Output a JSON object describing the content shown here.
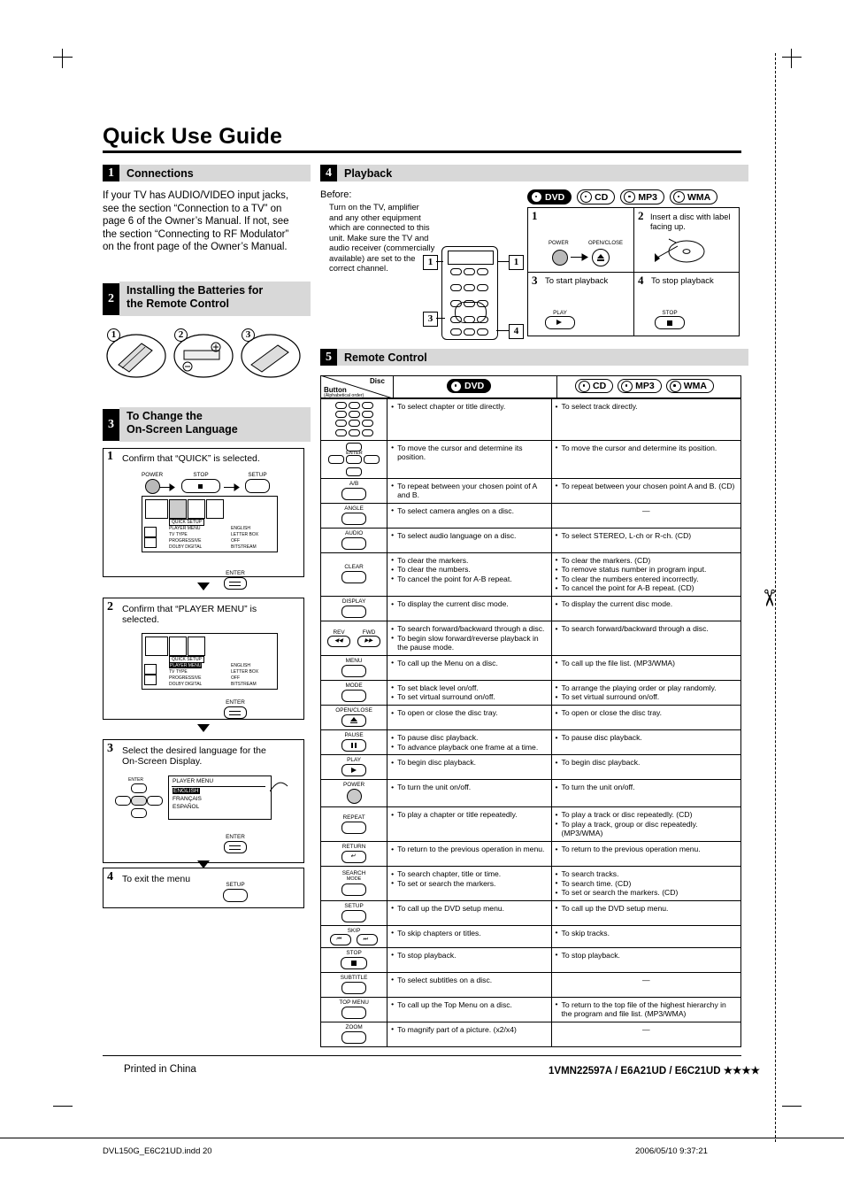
{
  "title": "Quick Use Guide",
  "sections": {
    "s1": {
      "num": "1",
      "title": "Connections",
      "body": "If your TV has AUDIO/VIDEO input jacks, see the section “Connection to a TV” on page 6 of the Owner’s Manual. If not, see the section “Connecting to RF Modulator” on the front page of the Owner’s Manual."
    },
    "s2": {
      "num": "2",
      "title_l1": "Installing the Batteries for",
      "title_l2": "the Remote Control",
      "steps": [
        "1",
        "2",
        "3"
      ]
    },
    "s3": {
      "num": "3",
      "title_l1": "To Change the",
      "title_l2": "On-Screen Language",
      "step1": {
        "n": "1",
        "text": "Confirm that “QUICK” is selected.",
        "power": "POWER",
        "stop": "STOP",
        "setup": "SETUP",
        "enter": "ENTER",
        "osd_title": "QUICK SETUP",
        "osd_rows": [
          {
            "l": "PLAYER MENU",
            "r": "ENGLISH"
          },
          {
            "l": "TV TYPE",
            "r": "LETTER BOX"
          },
          {
            "l": "PROGRESSIVE",
            "r": "OFF"
          },
          {
            "l": "DOLBY DIGITAL",
            "r": "BITSTREAM"
          }
        ]
      },
      "step2": {
        "n": "2",
        "text": "Confirm that “PLAYER MENU” is selected.",
        "enter": "ENTER",
        "osd_title": "QUICK SETUP",
        "osd_rows": [
          {
            "l": "PLAYER MENU",
            "r": "ENGLISH"
          },
          {
            "l": "TV TYPE",
            "r": "LETTER BOX"
          },
          {
            "l": "PROGRESSIVE",
            "r": "OFF"
          },
          {
            "l": "DOLBY DIGITAL",
            "r": "BITSTREAM"
          }
        ]
      },
      "step3": {
        "n": "3",
        "text_l1": "Select the desired language for the",
        "text_l2": "On-Screen Display.",
        "enter": "ENTER",
        "menu_title": "PLAYER MENU",
        "menu_items": [
          "ENGLISH",
          "FRANÇAIS",
          "ESPAÑOL"
        ]
      },
      "step4": {
        "n": "4",
        "text": "To exit the menu",
        "setup": "SETUP"
      }
    },
    "s4": {
      "num": "4",
      "title": "Playback",
      "before_label": "Before:",
      "before_text": "Turn on the TV, amplifier and any other equipment which are connected to this unit. Make sure the TV and audio receiver (commercially available) are set to the correct channel.",
      "badges": [
        "DVD",
        "CD",
        "MP3",
        "WMA"
      ],
      "steps": [
        {
          "n": "1",
          "label": "",
          "power": "POWER",
          "openclose": "OPEN/CLOSE"
        },
        {
          "n": "2",
          "label": "Insert a disc with label facing up."
        },
        {
          "n": "3",
          "label": "To start playback",
          "key": "PLAY"
        },
        {
          "n": "4",
          "label": "To stop playback",
          "key": "STOP"
        }
      ],
      "remote_callouts": [
        "1",
        "1",
        "3",
        "4"
      ]
    },
    "s5": {
      "num": "5",
      "title": "Remote Control",
      "header": {
        "button": "Button",
        "alpha": "(Alphabetical order)",
        "disc": "Disc",
        "col2_badge": "DVD",
        "col3_badges": [
          "CD",
          "MP3",
          "WMA"
        ]
      },
      "rows": [
        {
          "key": "NUMBER",
          "key_type": "numpad",
          "dvd": [
            "To select chapter or title directly."
          ],
          "cd": [
            "To select track directly."
          ]
        },
        {
          "key": "ENTER",
          "key_type": "cursor",
          "dvd": [
            "To move the cursor and determine its position."
          ],
          "cd": [
            "To move the cursor and determine its position."
          ]
        },
        {
          "key": "A/B",
          "key_type": "oval",
          "dvd": [
            "To repeat between your chosen point of A and B."
          ],
          "cd": [
            "To repeat between your chosen point A and B. (CD)"
          ]
        },
        {
          "key": "ANGLE",
          "key_type": "oval",
          "dvd": [
            "To select camera angles on a disc."
          ],
          "cd": [
            "—"
          ]
        },
        {
          "key": "AUDIO",
          "key_type": "oval",
          "dvd": [
            "To select audio language on a disc."
          ],
          "cd": [
            "To select STEREO, L-ch or R-ch. (CD)"
          ]
        },
        {
          "key": "CLEAR",
          "key_type": "oval",
          "dvd": [
            "To clear the markers.",
            "To clear the numbers.",
            "To cancel the point for A-B repeat."
          ],
          "cd": [
            "To clear the markers. (CD)",
            "To remove status number in program input.",
            "To clear the numbers entered incorrectly.",
            "To cancel the point for A-B repeat. (CD)"
          ]
        },
        {
          "key": "DISPLAY",
          "key_type": "oval",
          "dvd": [
            "To display the current disc mode."
          ],
          "cd": [
            "To display the current disc mode."
          ]
        },
        {
          "key": "REV/FWD",
          "key_type": "revfwd",
          "dvd": [
            "To search forward/backward through a disc.",
            "To begin slow forward/reverse playback in the pause mode."
          ],
          "cd": [
            "To search forward/backward through a disc."
          ]
        },
        {
          "key": "MENU",
          "key_type": "oval",
          "dvd": [
            "To call up the Menu on a disc."
          ],
          "cd": [
            "To call up the file list. (MP3/WMA)"
          ]
        },
        {
          "key": "MODE",
          "key_type": "oval",
          "dvd": [
            "To set black level on/off.",
            "To set virtual surround on/off."
          ],
          "cd": [
            "To arrange the playing order or play randomly.",
            "To set virtual surround on/off."
          ]
        },
        {
          "key": "OPEN/CLOSE",
          "key_type": "oval-eject",
          "dvd": [
            "To open or close the disc tray."
          ],
          "cd": [
            "To open or close the disc tray."
          ]
        },
        {
          "key": "PAUSE",
          "key_type": "oval-pause",
          "dvd": [
            "To pause disc playback.",
            "To advance playback one frame at a time."
          ],
          "cd": [
            "To pause disc playback."
          ]
        },
        {
          "key": "PLAY",
          "key_type": "oval-play",
          "dvd": [
            "To begin disc playback."
          ],
          "cd": [
            "To begin disc playback."
          ]
        },
        {
          "key": "POWER",
          "key_type": "round",
          "dvd": [
            "To turn the unit on/off."
          ],
          "cd": [
            "To turn the unit on/off."
          ]
        },
        {
          "key": "REPEAT",
          "key_type": "oval",
          "dvd": [
            "To play a chapter or title repeatedly."
          ],
          "cd": [
            "To play a track or disc repeatedly. (CD)",
            "To play a track, group or disc repeatedly. (MP3/WMA)"
          ]
        },
        {
          "key": "RETURN",
          "key_type": "oval-return",
          "dvd": [
            "To return to the previous operation in menu."
          ],
          "cd": [
            "To return to the previous operation menu."
          ]
        },
        {
          "key": "SEARCH MODE",
          "key_type": "oval-two",
          "dvd": [
            "To search chapter, title or time.",
            "To set or search the markers."
          ],
          "cd": [
            "To search tracks.",
            "To search time. (CD)",
            "To set or search the markers. (CD)"
          ]
        },
        {
          "key": "SETUP",
          "key_type": "oval",
          "dvd": [
            "To call up the DVD setup menu."
          ],
          "cd": [
            "To call up the DVD setup menu."
          ]
        },
        {
          "key": "SKIP",
          "key_type": "skip",
          "dvd": [
            "To skip chapters or titles."
          ],
          "cd": [
            "To skip tracks."
          ]
        },
        {
          "key": "STOP",
          "key_type": "oval-stop",
          "dvd": [
            "To stop playback."
          ],
          "cd": [
            "To stop playback."
          ]
        },
        {
          "key": "SUBTITLE",
          "key_type": "oval",
          "dvd": [
            "To select subtitles on a disc."
          ],
          "cd": [
            "—"
          ]
        },
        {
          "key": "TOP MENU",
          "key_type": "oval",
          "dvd": [
            "To call up the Top Menu on a disc."
          ],
          "cd": [
            "To return to the top file of the highest hierarchy in the program and file list. (MP3/WMA)"
          ]
        },
        {
          "key": "ZOOM",
          "key_type": "oval",
          "dvd": [
            "To magnify part of a picture. (x2/x4)"
          ],
          "cd": [
            "—"
          ]
        }
      ]
    }
  },
  "footer": {
    "printed": "Printed in China",
    "code": "1VMN22597A / E6A21UD / E6C21UD ★★★★"
  },
  "bottom": {
    "left": "DVL150G_E6C21UD.indd   20",
    "right": "2006/05/10   9:37:21"
  }
}
